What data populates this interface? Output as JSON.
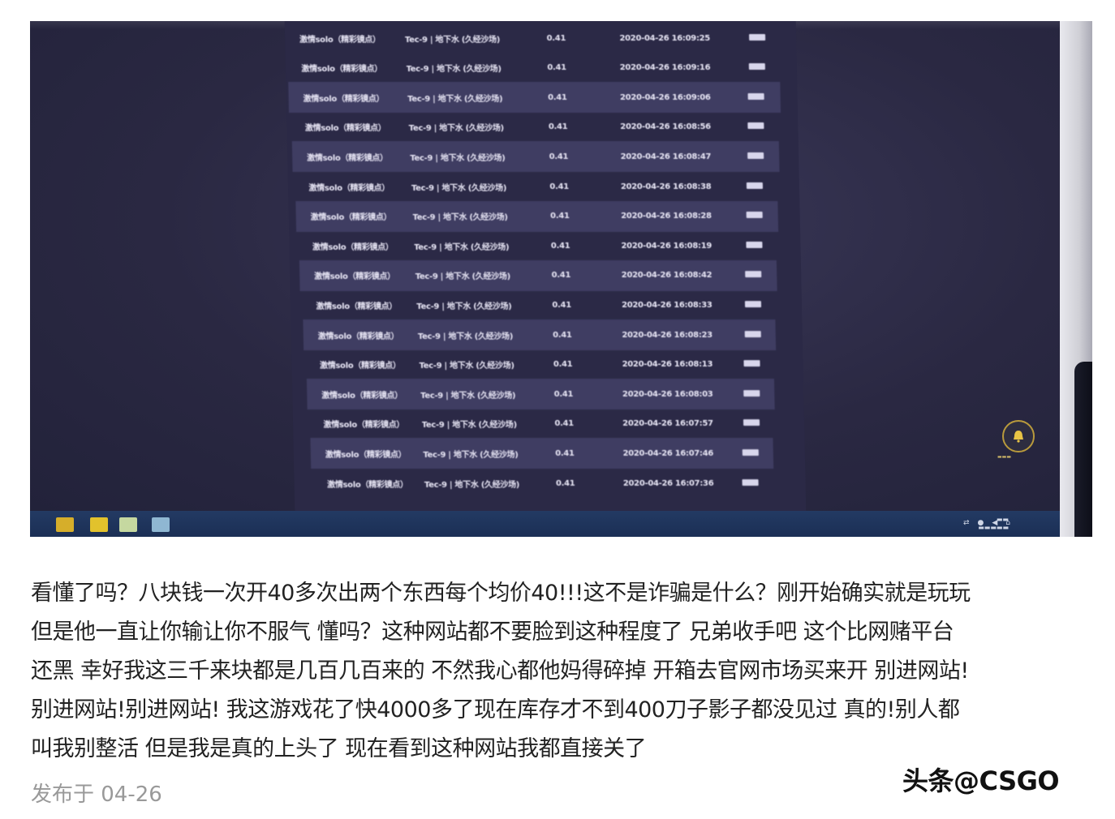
{
  "history": {
    "rows": [
      {
        "name": "激情solo（精彩镜点）",
        "item": "Tec-9 | 地下水 (久经沙场)",
        "price": "0.41",
        "time": "2020-04-26 16:09:25",
        "alt": false
      },
      {
        "name": "激情solo（精彩镜点）",
        "item": "Tec-9 | 地下水 (久经沙场)",
        "price": "0.41",
        "time": "2020-04-26 16:09:16",
        "alt": false
      },
      {
        "name": "激情solo（精彩镜点）",
        "item": "Tec-9 | 地下水 (久经沙场)",
        "price": "0.41",
        "time": "2020-04-26 16:09:06",
        "alt": true
      },
      {
        "name": "激情solo（精彩镜点）",
        "item": "Tec-9 | 地下水 (久经沙场)",
        "price": "0.41",
        "time": "2020-04-26 16:08:56",
        "alt": false
      },
      {
        "name": "激情solo（精彩镜点）",
        "item": "Tec-9 | 地下水 (久经沙场)",
        "price": "0.41",
        "time": "2020-04-26 16:08:47",
        "alt": true
      },
      {
        "name": "激情solo（精彩镜点）",
        "item": "Tec-9 | 地下水 (久经沙场)",
        "price": "0.41",
        "time": "2020-04-26 16:08:38",
        "alt": false
      },
      {
        "name": "激情solo（精彩镜点）",
        "item": "Tec-9 | 地下水 (久经沙场)",
        "price": "0.41",
        "time": "2020-04-26 16:08:28",
        "alt": true
      },
      {
        "name": "激情solo（精彩镜点）",
        "item": "Tec-9 | 地下水 (久经沙场)",
        "price": "0.41",
        "time": "2020-04-26 16:08:19",
        "alt": false
      },
      {
        "name": "激情solo（精彩镜点）",
        "item": "Tec-9 | 地下水 (久经沙场)",
        "price": "0.41",
        "time": "2020-04-26 16:08:42",
        "alt": true
      },
      {
        "name": "激情solo（精彩镜点）",
        "item": "Tec-9 | 地下水 (久经沙场)",
        "price": "0.41",
        "time": "2020-04-26 16:08:33",
        "alt": false
      },
      {
        "name": "激情solo（精彩镜点）",
        "item": "Tec-9 | 地下水 (久经沙场)",
        "price": "0.41",
        "time": "2020-04-26 16:08:23",
        "alt": true
      },
      {
        "name": "激情solo（精彩镜点）",
        "item": "Tec-9 | 地下水 (久经沙场)",
        "price": "0.41",
        "time": "2020-04-26 16:08:13",
        "alt": false
      },
      {
        "name": "激情solo（精彩镜点）",
        "item": "Tec-9 | 地下水 (久经沙场)",
        "price": "0.41",
        "time": "2020-04-26 16:08:03",
        "alt": true
      },
      {
        "name": "激情solo（精彩镜点）",
        "item": "Tec-9 | 地下水 (久经沙场)",
        "price": "0.41",
        "time": "2020-04-26 16:07:57",
        "alt": false
      },
      {
        "name": "激情solo（精彩镜点）",
        "item": "Tec-9 | 地下水 (久经沙场)",
        "price": "0.41",
        "time": "2020-04-26 16:07:46",
        "alt": true
      },
      {
        "name": "激情solo（精彩镜点）",
        "item": "Tec-9 | 地下水 (久经沙场)",
        "price": "0.41",
        "time": "2020-04-26 16:07:36",
        "alt": false
      }
    ]
  },
  "post": {
    "lines": [
      "看懂了吗？八块钱一次开40多次出两个东西每个均价40!!!这不是诈骗是什么？刚开始确实就是玩玩",
      "但是他一直让你输让你不服气 懂吗？这种网站都不要脸到这种程度了 兄弟收手吧 这个比网赌平台",
      "还黑 幸好我这三千来块都是几百几百来的 不然我心都他妈得碎掉 开箱去官网市场买来开 别进网站!",
      "别进网站!别进网站! 我这游戏花了快4000多了现在库存才不到400刀子影子都没见过 真的!别人都",
      "叫我别整活 但是我是真的上头了 现在看到这种网站我都直接关了"
    ],
    "publish_time": "发布于 04-26",
    "watermark": "头条@CSGO"
  },
  "colors": {
    "screen_bg": "#2a2842",
    "row_alt": "#3f3d62",
    "taskbar": "#1b2f55",
    "text": "#222222",
    "meta": "#999999"
  }
}
